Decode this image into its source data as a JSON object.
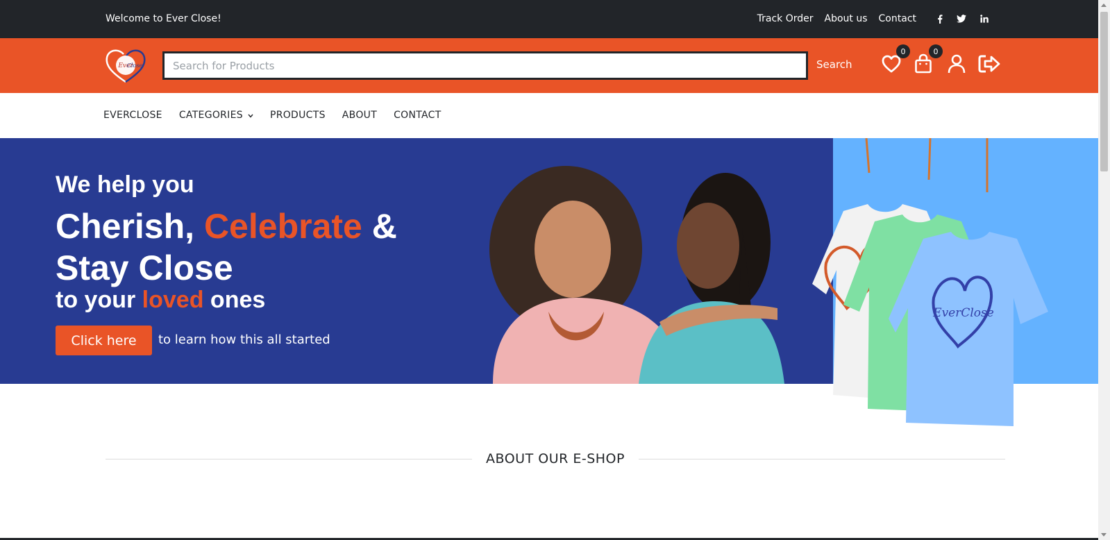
{
  "topbar": {
    "welcome": "Welcome to Ever Close!",
    "links": [
      "Track Order",
      "About us",
      "Contact"
    ],
    "social_icons": [
      "facebook-icon",
      "twitter-icon",
      "linkedin-icon"
    ]
  },
  "header": {
    "logo_text": "Ever Close",
    "search_placeholder": "Search for Products",
    "search_label": "Search",
    "wishlist_count": "0",
    "cart_count": "0",
    "icons": [
      "heart-icon",
      "shopping-bag-icon",
      "user-icon",
      "logout-icon"
    ]
  },
  "nav": {
    "items": [
      "EVERCLOSE",
      "CATEGORIES",
      "PRODUCTS",
      "ABOUT",
      "CONTACT"
    ]
  },
  "hero": {
    "line1": "We help you",
    "line2_a": "Cherish, ",
    "line2_b": "Celebrate",
    "line2_c": " &",
    "line3": "Stay Close",
    "line4_a": "to your ",
    "line4_b": "loved",
    "line4_c": " ones",
    "cta_label": "Click here",
    "cta_text": "to learn how this all started",
    "shirt_logo_text": "EverClose"
  },
  "about": {
    "title": "ABOUT OUR E-SHOP"
  },
  "colors": {
    "dark": "#222529",
    "brand_orange": "#e95427",
    "hero_blue": "#283b92",
    "light_blue": "#64b2ff"
  }
}
